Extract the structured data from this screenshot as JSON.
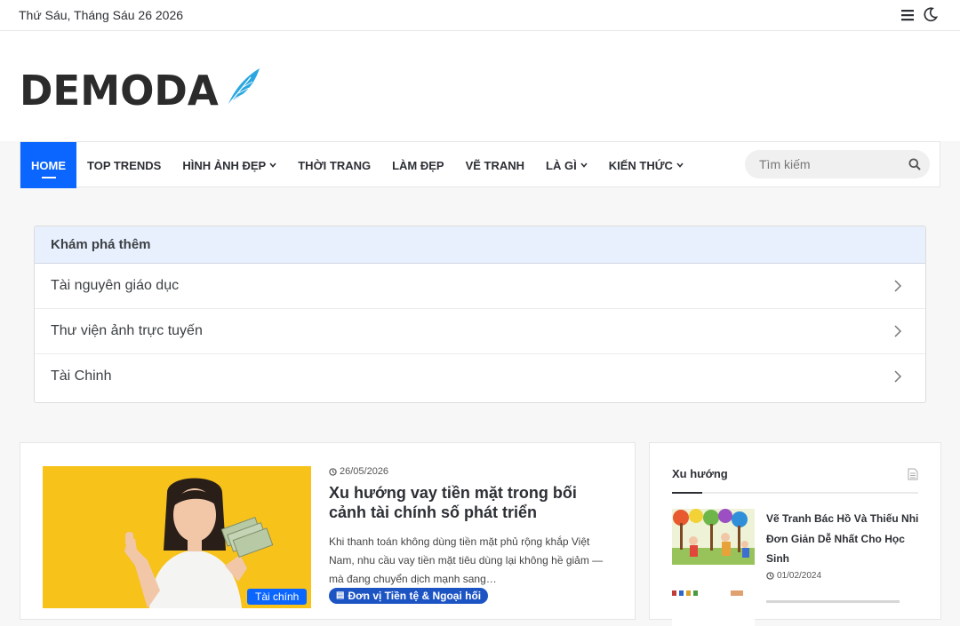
{
  "topbar": {
    "date": "Thứ Sáu, Tháng Sáu 26 2026"
  },
  "header": {
    "logo_text": "DEMODA"
  },
  "nav": {
    "items": [
      {
        "label": "HOME"
      },
      {
        "label": "TOP TRENDS"
      },
      {
        "label": "HÌNH ẢNH ĐẸP"
      },
      {
        "label": "THỜI TRANG"
      },
      {
        "label": "LÀM ĐẸP"
      },
      {
        "label": "VẼ TRANH"
      },
      {
        "label": "LÀ GÌ"
      },
      {
        "label": "KIẾN THỨC"
      }
    ],
    "search_placeholder": "Tìm kiếm"
  },
  "explore": {
    "heading": "Khám phá thêm",
    "items": [
      {
        "label": "Tài nguyên giáo dục"
      },
      {
        "label": "Thư viện ảnh trực tuyến"
      },
      {
        "label": "Tài Chinh"
      }
    ]
  },
  "post": {
    "category": "Tài chính",
    "date": "26/05/2026",
    "title": "Xu hướng vay tiền mặt trong bối cảnh tài chính số phát triển",
    "excerpt": "Khi thanh toán không dùng tiền mặt phủ rộng khắp Việt Nam, nhu cầu vay tiền mặt tiêu dùng lại không hề giảm — mà đang chuyển dịch mạnh sang…",
    "tag": "Đơn vị Tiền tệ & Ngoại hối"
  },
  "sidebar": {
    "title": "Xu hướng",
    "items": [
      {
        "title": "Vẽ Tranh Bác Hồ Và Thiếu Nhi Đơn Giản Dễ Nhất Cho Học Sinh",
        "date": "01/02/2024"
      }
    ]
  },
  "colors": {
    "accent": "#0b66ff",
    "tag": "#1c54c4",
    "explore_head": "#e8f0fe"
  }
}
